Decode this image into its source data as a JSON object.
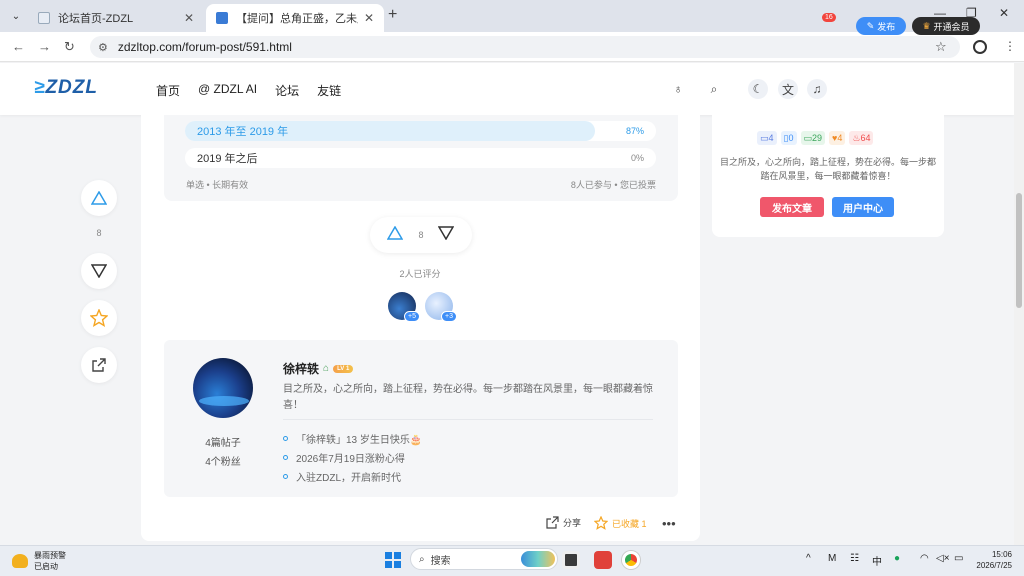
{
  "browser": {
    "tabs": [
      {
        "title": "论坛首页-ZDZL",
        "active": false
      },
      {
        "title": "【提问】总角正盛，乙未月轮：应",
        "active": true
      }
    ],
    "url": "zdzltop.com/forum-post/591.html"
  },
  "site": {
    "logo": "ZDZL",
    "nav": [
      "首页",
      "@ ZDZL AI",
      "论坛",
      "友链"
    ],
    "notification_count": "16",
    "publish_label": "发布",
    "vip_label": "开通会员"
  },
  "poll": {
    "options": [
      {
        "label": "2013 年至 2019 年",
        "percent": "87%",
        "fill": 0.87,
        "active": true
      },
      {
        "label": "2019 年之后",
        "percent": "0%",
        "fill": 0,
        "active": false
      }
    ],
    "type_label": "单选 • 长期有效",
    "stats_label": "8人已参与 • 您已投票"
  },
  "float": {
    "vote_count": "8"
  },
  "vote": {
    "count": "8",
    "rated_text": "2人已评分",
    "avatars": [
      {
        "plus": "+5"
      },
      {
        "plus": "+3"
      }
    ]
  },
  "author": {
    "name": "徐梓轶",
    "level": "LV 1",
    "bio": "目之所及，心之所向，踏上征程，势在必得。每一步都踏在风景里，每一眼都藏着惊喜！",
    "posts": "4篇帖子",
    "fans": "4个粉丝",
    "items": [
      "「徐梓轶」13 岁生日快乐🎂",
      "2026年7月19日涨粉心得",
      "入驻ZDZL，开启新时代"
    ]
  },
  "post_actions": {
    "share": "分享",
    "favorited": "已收藏 1"
  },
  "sidebar": {
    "badges": [
      {
        "text": "4",
        "color": "#5b7de0",
        "bg": "#eaf0fc"
      },
      {
        "text": "0",
        "color": "#3e8ef7",
        "bg": "#e8f2fe"
      },
      {
        "text": "29",
        "color": "#3aa55a",
        "bg": "#e7f6eb"
      },
      {
        "text": "4",
        "color": "#f08a24",
        "bg": "#fdf0e2"
      },
      {
        "text": "64",
        "color": "#ef4d4d",
        "bg": "#fde9e9"
      }
    ],
    "bio": "目之所及，心之所向，踏上征程，势在必得。每一步都踏在风景里，每一眼都藏着惊喜！",
    "btn_publish": "发布文章",
    "btn_user": "用户中心"
  },
  "taskbar": {
    "weather_title": "暴雨预警",
    "weather_sub": "已启动",
    "search": "搜索",
    "ime": "中",
    "time": "15:06",
    "date": "2026/7/25"
  },
  "colors": {
    "accent": "#2d9be8",
    "publish": "#f0576b",
    "user_center": "#3e8ef7",
    "favorite": "#f5a623"
  }
}
